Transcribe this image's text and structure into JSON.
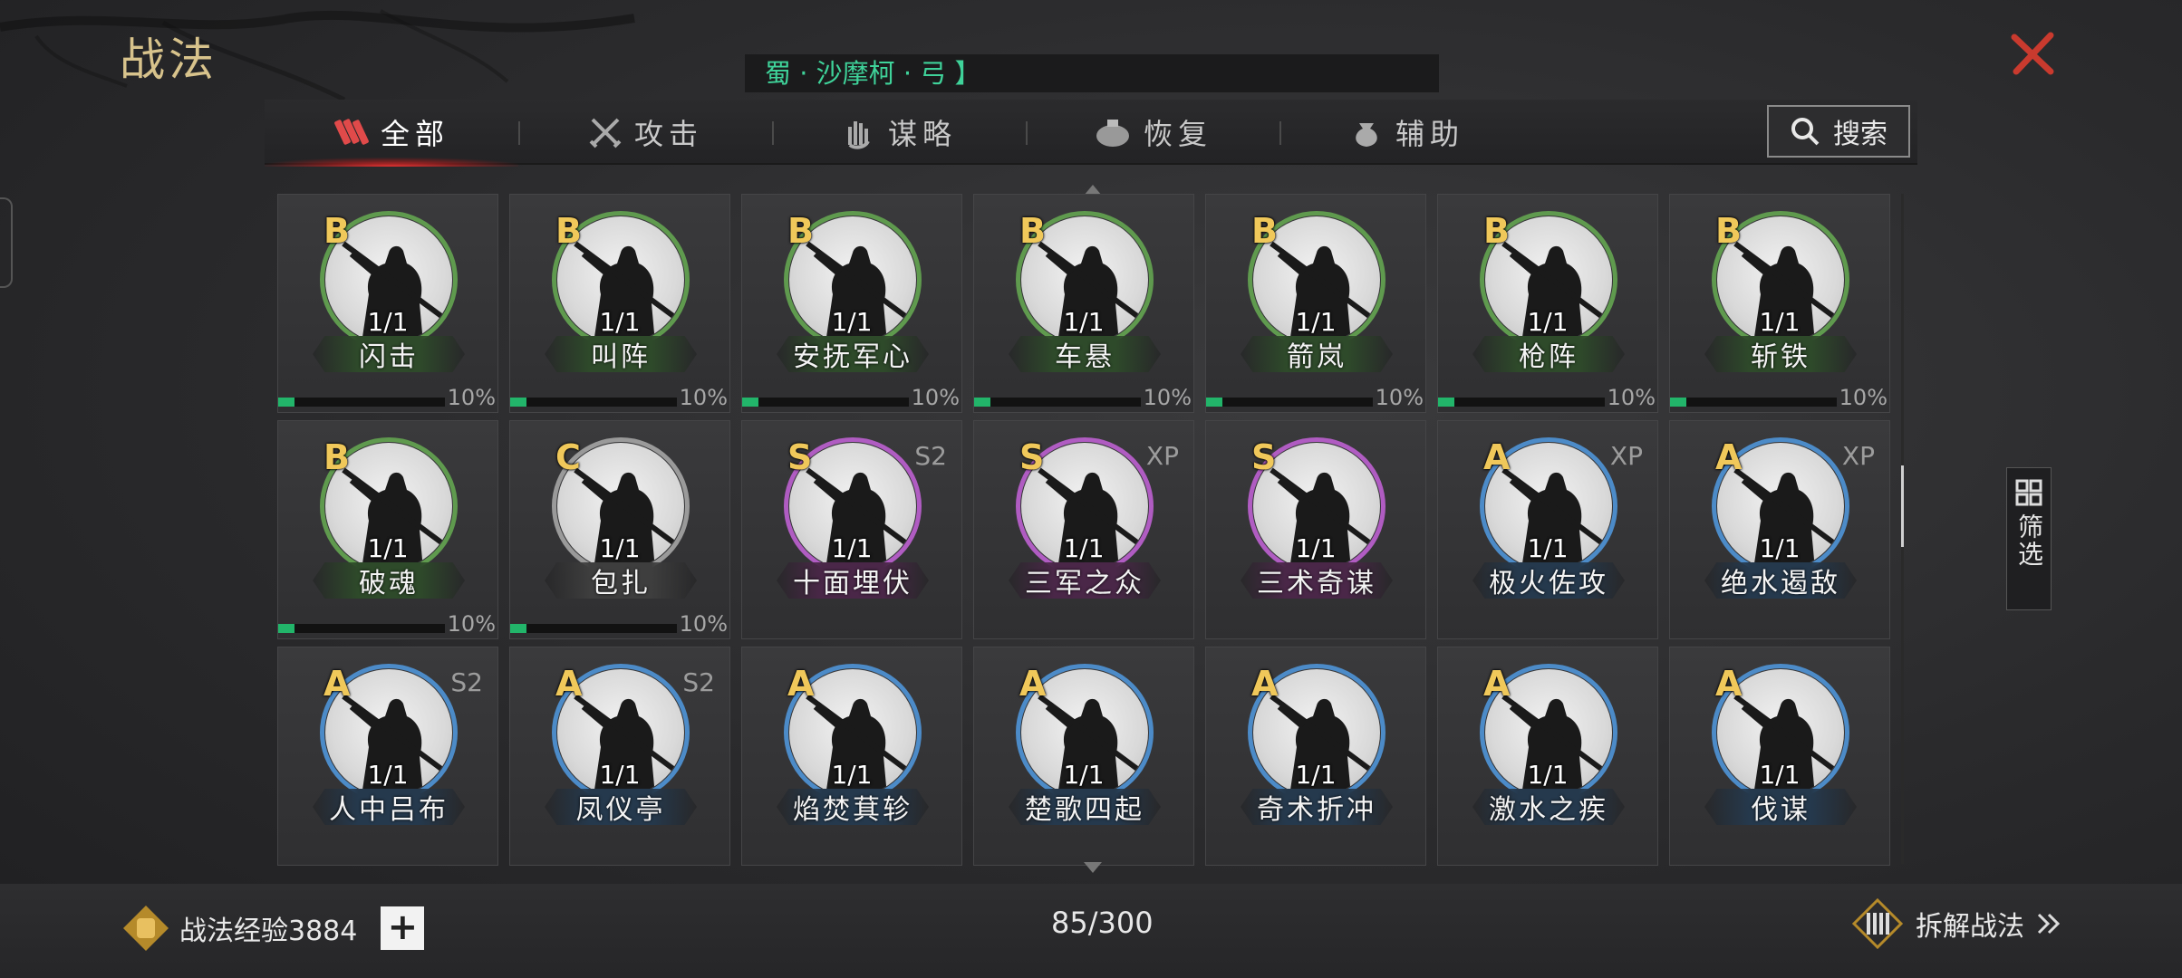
{
  "page": {
    "title": "战法",
    "notice": "蜀 · 沙摩柯 · 弓 】"
  },
  "tabs": [
    {
      "label": "全部",
      "icon": "all-scrolls-icon",
      "active": true
    },
    {
      "label": "攻击",
      "icon": "crossed-swords-icon",
      "active": false
    },
    {
      "label": "谋略",
      "icon": "hand-strategy-icon",
      "active": false
    },
    {
      "label": "恢复",
      "icon": "medicine-icon",
      "active": false
    },
    {
      "label": "辅助",
      "icon": "pouch-icon",
      "active": false
    }
  ],
  "search": {
    "label": "搜索"
  },
  "filter": {
    "label": "筛选"
  },
  "colors": {
    "B": "#5f9a4e",
    "C": "#9a9a9a",
    "S": "#b05cc2",
    "A": "#4c8bc8",
    "progress": "#22b56a",
    "grade_text": "#f0c85a"
  },
  "cards": [
    {
      "grade": "B",
      "name": "闪击",
      "count": "1/1",
      "tag": "",
      "progress": 10,
      "pct": "10%"
    },
    {
      "grade": "B",
      "name": "叫阵",
      "count": "1/1",
      "tag": "",
      "progress": 10,
      "pct": "10%"
    },
    {
      "grade": "B",
      "name": "安抚军心",
      "count": "1/1",
      "tag": "",
      "progress": 10,
      "pct": "10%"
    },
    {
      "grade": "B",
      "name": "车悬",
      "count": "1/1",
      "tag": "",
      "progress": 10,
      "pct": "10%"
    },
    {
      "grade": "B",
      "name": "箭岚",
      "count": "1/1",
      "tag": "",
      "progress": 10,
      "pct": "10%"
    },
    {
      "grade": "B",
      "name": "枪阵",
      "count": "1/1",
      "tag": "",
      "progress": 10,
      "pct": "10%"
    },
    {
      "grade": "B",
      "name": "斩铁",
      "count": "1/1",
      "tag": "",
      "progress": 10,
      "pct": "10%"
    },
    {
      "grade": "B",
      "name": "破魂",
      "count": "1/1",
      "tag": "",
      "progress": 10,
      "pct": "10%"
    },
    {
      "grade": "C",
      "name": "包扎",
      "count": "1/1",
      "tag": "",
      "progress": 10,
      "pct": "10%"
    },
    {
      "grade": "S",
      "name": "十面埋伏",
      "count": "1/1",
      "tag": "S2",
      "progress": null,
      "pct": ""
    },
    {
      "grade": "S",
      "name": "三军之众",
      "count": "1/1",
      "tag": "XP",
      "progress": null,
      "pct": ""
    },
    {
      "grade": "S",
      "name": "三术奇谋",
      "count": "1/1",
      "tag": "",
      "progress": null,
      "pct": ""
    },
    {
      "grade": "A",
      "name": "极火佐攻",
      "count": "1/1",
      "tag": "XP",
      "progress": null,
      "pct": ""
    },
    {
      "grade": "A",
      "name": "绝水遏敌",
      "count": "1/1",
      "tag": "XP",
      "progress": null,
      "pct": ""
    },
    {
      "grade": "A",
      "name": "人中吕布",
      "count": "1/1",
      "tag": "S2",
      "progress": null,
      "pct": ""
    },
    {
      "grade": "A",
      "name": "凤仪亭",
      "count": "1/1",
      "tag": "S2",
      "progress": null,
      "pct": ""
    },
    {
      "grade": "A",
      "name": "焰焚萁轸",
      "count": "1/1",
      "tag": "",
      "progress": null,
      "pct": ""
    },
    {
      "grade": "A",
      "name": "楚歌四起",
      "count": "1/1",
      "tag": "",
      "progress": null,
      "pct": ""
    },
    {
      "grade": "A",
      "name": "奇术折冲",
      "count": "1/1",
      "tag": "",
      "progress": null,
      "pct": ""
    },
    {
      "grade": "A",
      "name": "激水之疾",
      "count": "1/1",
      "tag": "",
      "progress": null,
      "pct": ""
    },
    {
      "grade": "A",
      "name": "伐谋",
      "count": "1/1",
      "tag": "",
      "progress": null,
      "pct": ""
    }
  ],
  "footer": {
    "exp_label": "战法经验3884",
    "plus": "+",
    "capacity": "85/300",
    "dismantle_label": "拆解战法"
  }
}
